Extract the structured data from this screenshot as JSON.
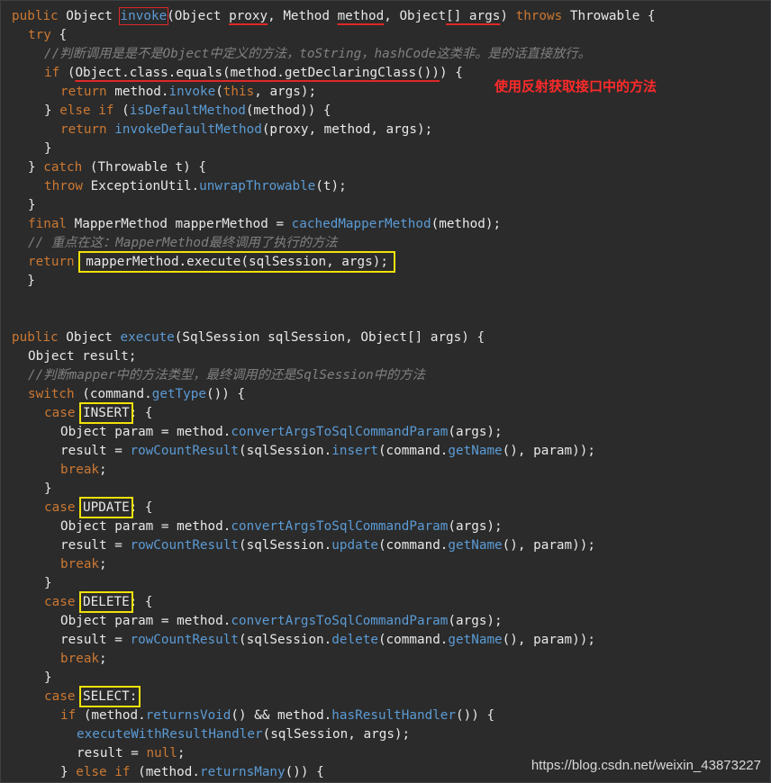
{
  "editor": {
    "lines": [
      {
        "indent": 0,
        "tokens": [
          [
            "kw",
            "public "
          ],
          [
            "txt",
            "Object "
          ],
          [
            "fn",
            "invoke",
            "red"
          ],
          [
            "txt",
            "(Object "
          ],
          [
            "txt",
            "proxy",
            "ul"
          ],
          [
            "txt",
            ", Method "
          ],
          [
            "txt",
            "method",
            "ul"
          ],
          [
            "txt",
            ", Object"
          ],
          [
            "txt",
            "[] args",
            "ul"
          ],
          [
            "txt",
            ") "
          ],
          [
            "kw",
            "throws "
          ],
          [
            "txt",
            "Throwable {"
          ]
        ]
      },
      {
        "indent": 1,
        "tokens": [
          [
            "kw",
            "try "
          ],
          [
            "txt",
            "{"
          ]
        ]
      },
      {
        "indent": 2,
        "tokens": [
          [
            "cmt",
            "//判断调用是是不是Object中定义的方法，toString，hashCode这类非。是的话直接放行。"
          ]
        ]
      },
      {
        "indent": 2,
        "tokens": [
          [
            "kw",
            "if "
          ],
          [
            "txt",
            "("
          ],
          [
            "txt",
            "Object.class.equals(method.getDeclaringClass())",
            "ul"
          ],
          [
            "txt",
            ") {"
          ]
        ]
      },
      {
        "indent": 3,
        "tokens": [
          [
            "kw",
            "return "
          ],
          [
            "txt",
            "method."
          ],
          [
            "fn",
            "invoke"
          ],
          [
            "txt",
            "("
          ],
          [
            "kw",
            "this"
          ],
          [
            "txt",
            ", args);"
          ]
        ]
      },
      {
        "indent": 2,
        "tokens": [
          [
            "txt",
            "} "
          ],
          [
            "kw",
            "else if "
          ],
          [
            "txt",
            "("
          ],
          [
            "fn",
            "isDefaultMethod"
          ],
          [
            "txt",
            "(method)) {"
          ]
        ]
      },
      {
        "indent": 3,
        "tokens": [
          [
            "kw",
            "return "
          ],
          [
            "fn",
            "invokeDefaultMethod"
          ],
          [
            "txt",
            "(proxy, method, args);"
          ]
        ]
      },
      {
        "indent": 2,
        "tokens": [
          [
            "txt",
            "}"
          ]
        ]
      },
      {
        "indent": 1,
        "tokens": [
          [
            "txt",
            "} "
          ],
          [
            "kw",
            "catch "
          ],
          [
            "txt",
            "(Throwable t) {"
          ]
        ]
      },
      {
        "indent": 2,
        "tokens": [
          [
            "kw",
            "throw "
          ],
          [
            "txt",
            "ExceptionUtil."
          ],
          [
            "fn",
            "unwrapThrowable"
          ],
          [
            "txt",
            "(t);"
          ]
        ]
      },
      {
        "indent": 1,
        "tokens": [
          [
            "txt",
            "}"
          ]
        ]
      },
      {
        "indent": 1,
        "tokens": [
          [
            "kw",
            "final "
          ],
          [
            "txt",
            "MapperMethod mapperMethod = "
          ],
          [
            "fn",
            "cachedMapperMethod"
          ],
          [
            "txt",
            "(method);"
          ]
        ]
      },
      {
        "indent": 1,
        "tokens": [
          [
            "cmt",
            "// 重点在这：MapperMethod最终调用了执行的方法"
          ]
        ]
      },
      {
        "indent": 1,
        "tokens": [
          [
            "kw",
            "return "
          ],
          [
            "boxline",
            "mapperMethod.execute(sqlSession, args);"
          ]
        ]
      },
      {
        "indent": 0,
        "tokens": [
          [
            "txt",
            "  }"
          ]
        ]
      },
      {
        "indent": 0,
        "tokens": []
      },
      {
        "indent": 0,
        "tokens": []
      },
      {
        "indent": 0,
        "tokens": [
          [
            "kw",
            "public "
          ],
          [
            "txt",
            "Object "
          ],
          [
            "fn",
            "execute"
          ],
          [
            "txt",
            "(SqlSession sqlSession, Object[] args) {"
          ]
        ]
      },
      {
        "indent": 1,
        "tokens": [
          [
            "txt",
            "Object result;"
          ]
        ]
      },
      {
        "indent": 1,
        "tokens": [
          [
            "cmt",
            "//判断mapper中的方法类型，最终调用的还是SqlSession中的方法"
          ]
        ]
      },
      {
        "indent": 1,
        "tokens": [
          [
            "kw",
            "switch "
          ],
          [
            "txt",
            "(command."
          ],
          [
            "fn",
            "getType"
          ],
          [
            "txt",
            "()) {"
          ]
        ]
      },
      {
        "indent": 2,
        "tokens": [
          [
            "kw",
            "case "
          ],
          [
            "yl",
            "INSERT"
          ],
          [
            "txt",
            ": {"
          ]
        ]
      },
      {
        "indent": 3,
        "tokens": [
          [
            "txt",
            "Object param = method."
          ],
          [
            "fn",
            "convertArgsToSqlCommandParam"
          ],
          [
            "txt",
            "(args);"
          ]
        ]
      },
      {
        "indent": 3,
        "tokens": [
          [
            "txt",
            "result = "
          ],
          [
            "fn",
            "rowCountResult"
          ],
          [
            "txt",
            "(sqlSession."
          ],
          [
            "fn",
            "insert"
          ],
          [
            "txt",
            "(command."
          ],
          [
            "fn",
            "getName"
          ],
          [
            "txt",
            "(), param));"
          ]
        ]
      },
      {
        "indent": 3,
        "tokens": [
          [
            "kw",
            "break"
          ],
          [
            "txt",
            ";"
          ]
        ]
      },
      {
        "indent": 2,
        "tokens": [
          [
            "txt",
            "}"
          ]
        ]
      },
      {
        "indent": 2,
        "tokens": [
          [
            "kw",
            "case "
          ],
          [
            "yl",
            "UPDATE"
          ],
          [
            "txt",
            ": {"
          ]
        ]
      },
      {
        "indent": 3,
        "tokens": [
          [
            "txt",
            "Object param = method."
          ],
          [
            "fn",
            "convertArgsToSqlCommandParam"
          ],
          [
            "txt",
            "(args);"
          ]
        ]
      },
      {
        "indent": 3,
        "tokens": [
          [
            "txt",
            "result = "
          ],
          [
            "fn",
            "rowCountResult"
          ],
          [
            "txt",
            "(sqlSession."
          ],
          [
            "fn",
            "update"
          ],
          [
            "txt",
            "(command."
          ],
          [
            "fn",
            "getName"
          ],
          [
            "txt",
            "(), param));"
          ]
        ]
      },
      {
        "indent": 3,
        "tokens": [
          [
            "kw",
            "break"
          ],
          [
            "txt",
            ";"
          ]
        ]
      },
      {
        "indent": 2,
        "tokens": [
          [
            "txt",
            "}"
          ]
        ]
      },
      {
        "indent": 2,
        "tokens": [
          [
            "kw",
            "case "
          ],
          [
            "yl",
            "DELETE"
          ],
          [
            "txt",
            ": {"
          ]
        ]
      },
      {
        "indent": 3,
        "tokens": [
          [
            "txt",
            "Object param = method."
          ],
          [
            "fn",
            "convertArgsToSqlCommandParam"
          ],
          [
            "txt",
            "(args);"
          ]
        ]
      },
      {
        "indent": 3,
        "tokens": [
          [
            "txt",
            "result = "
          ],
          [
            "fn",
            "rowCountResult"
          ],
          [
            "txt",
            "(sqlSession."
          ],
          [
            "fn",
            "delete"
          ],
          [
            "txt",
            "(command."
          ],
          [
            "fn",
            "getName"
          ],
          [
            "txt",
            "(), param));"
          ]
        ]
      },
      {
        "indent": 3,
        "tokens": [
          [
            "kw",
            "break"
          ],
          [
            "txt",
            ";"
          ]
        ]
      },
      {
        "indent": 2,
        "tokens": [
          [
            "txt",
            "}"
          ]
        ]
      },
      {
        "indent": 2,
        "tokens": [
          [
            "kw",
            "case "
          ],
          [
            "yl",
            "SELECT:"
          ]
        ]
      },
      {
        "indent": 3,
        "tokens": [
          [
            "kw",
            "if "
          ],
          [
            "txt",
            "(method."
          ],
          [
            "fn",
            "returnsVoid"
          ],
          [
            "txt",
            "() && method."
          ],
          [
            "fn",
            "hasResultHandler"
          ],
          [
            "txt",
            "()) {"
          ]
        ]
      },
      {
        "indent": 4,
        "tokens": [
          [
            "fn",
            "executeWithResultHandler"
          ],
          [
            "txt",
            "(sqlSession, args);"
          ]
        ]
      },
      {
        "indent": 4,
        "tokens": [
          [
            "txt",
            "result = "
          ],
          [
            "kw",
            "null"
          ],
          [
            "txt",
            ";"
          ]
        ]
      },
      {
        "indent": 3,
        "tokens": [
          [
            "txt",
            "} "
          ],
          [
            "kw",
            "else if "
          ],
          [
            "txt",
            "(method."
          ],
          [
            "fn",
            "returnsMany"
          ],
          [
            "txt",
            "()) {"
          ]
        ]
      }
    ]
  },
  "annotation": {
    "text": "使用反射获取接口中的方法"
  },
  "watermark": {
    "text": "https://blog.csdn.net/weixin_43873227"
  },
  "colors": {
    "background": "#2b2b2b",
    "keyword": "#cc7832",
    "method": "#5b9bd5",
    "comment": "#808080",
    "highlight_red": "#e02828",
    "highlight_yellow": "#f1e20a"
  }
}
